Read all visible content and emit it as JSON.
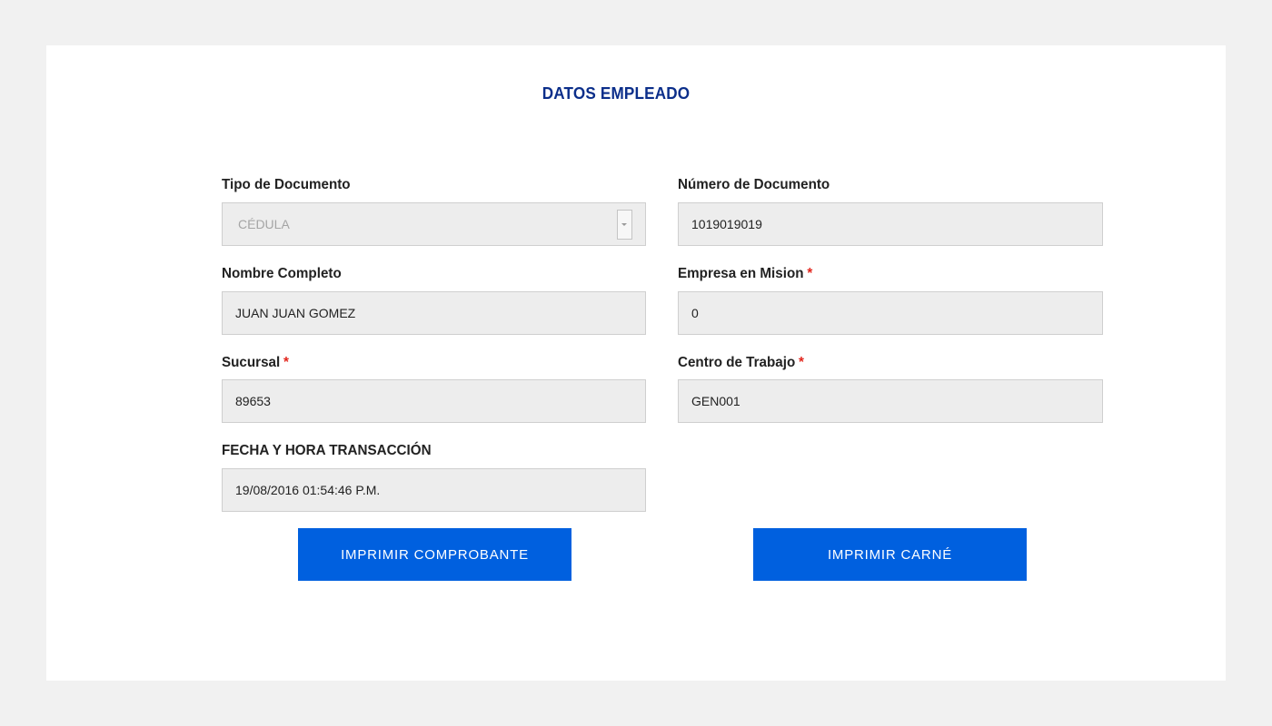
{
  "form": {
    "title": "DATOS EMPLEADO"
  },
  "fields": {
    "tipo_documento": {
      "label": "Tipo de Documento",
      "value": "CÉDULA"
    },
    "numero_documento": {
      "label": "Número de Documento",
      "value": "1019019019"
    },
    "nombre_completo": {
      "label": "Nombre Completo",
      "value": "JUAN JUAN GOMEZ"
    },
    "empresa_mision": {
      "label": "Empresa en Mision",
      "required_mark": "*",
      "value": "0"
    },
    "sucursal": {
      "label": "Sucursal",
      "required_mark": "*",
      "value": "89653"
    },
    "centro_trabajo": {
      "label": "Centro de Trabajo",
      "required_mark": "*",
      "value": "GEN001"
    },
    "fecha_hora": {
      "label": "FECHA Y HORA TRANSACCIÓN",
      "value": "19/08/2016 01:54:46 P.M."
    }
  },
  "buttons": {
    "imprimir_comprobante": "IMPRIMIR COMPROBANTE",
    "imprimir_carne": "IMPRIMIR CARNÉ"
  },
  "colors": {
    "title": "#0b2e8a",
    "button": "#0060df",
    "required": "#e2241b",
    "field_bg": "#ededed",
    "page_bg": "#f1f1f1"
  }
}
